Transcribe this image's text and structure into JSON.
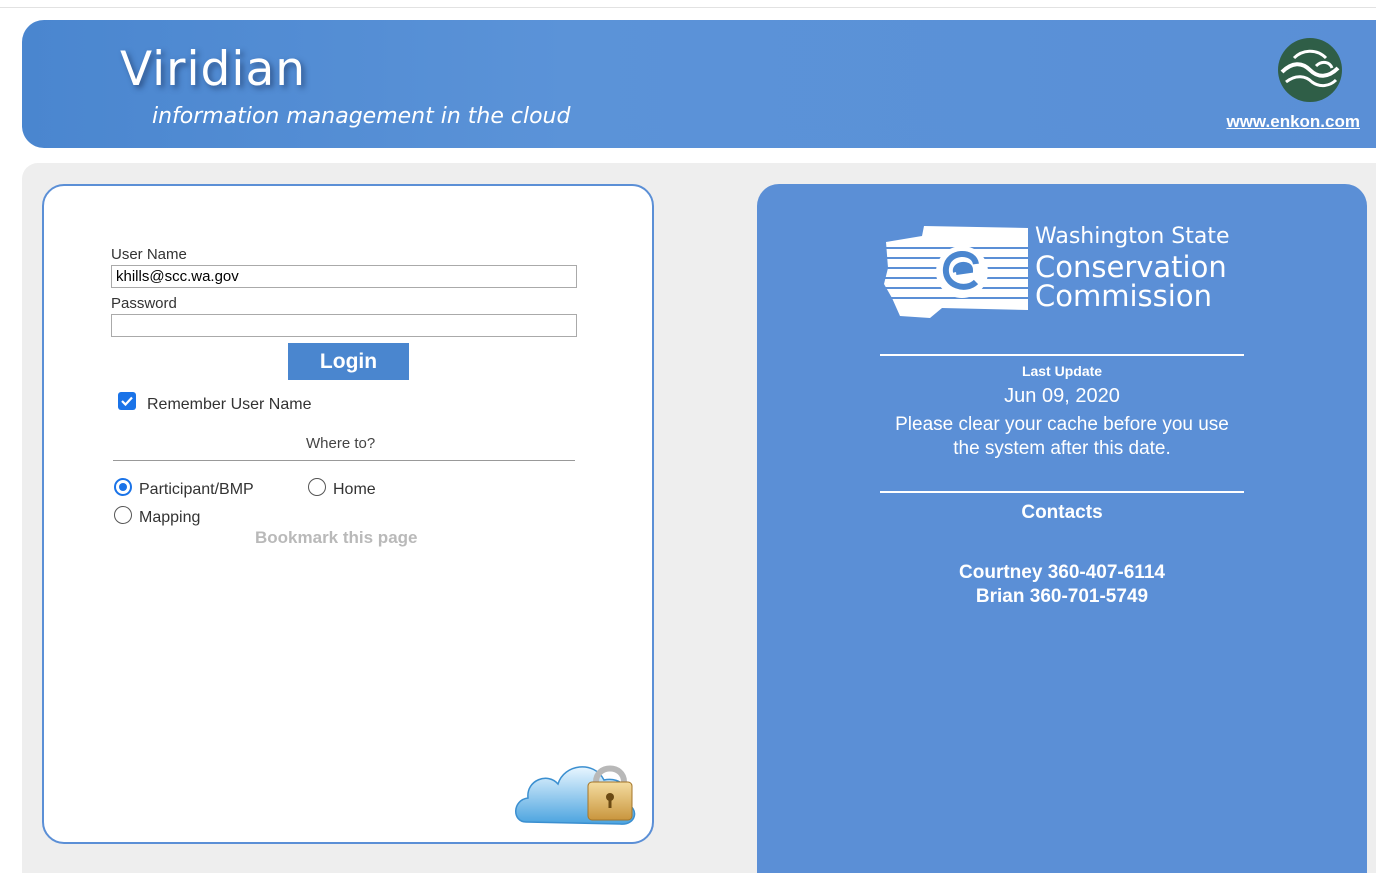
{
  "header": {
    "title": "Viridian",
    "tagline": "information management in the cloud",
    "link": "www.enkon.com"
  },
  "login": {
    "username_label": "User Name",
    "username_value": "khills@scc.wa.gov",
    "password_label": "Password",
    "password_value": "",
    "login_button": "Login",
    "remember_label": "Remember User Name",
    "remember_checked": true,
    "where_to_label": "Where to?",
    "destinations": [
      {
        "label": "Participant/BMP",
        "checked": true
      },
      {
        "label": "Home",
        "checked": false
      },
      {
        "label": "Mapping",
        "checked": false
      }
    ],
    "bookmark_label": "Bookmark this page"
  },
  "info": {
    "org_line1": "Washington State",
    "org_line2": "Conservation",
    "org_line3": "Commission",
    "last_update_label": "Last Update",
    "last_update_date": "Jun 09, 2020",
    "cache_notice_line1": "Please clear your cache before you use",
    "cache_notice_line2": "the system after this date.",
    "contacts_heading": "Contacts",
    "contacts": [
      "Courtney 360-407-6114",
      "Brian 360-701-5749"
    ]
  },
  "colors": {
    "brand_blue": "#5b8fd6",
    "button_blue": "#4a86cf",
    "check_blue": "#1a73e8"
  },
  "icons": [
    "enkon-wave-icon",
    "wscc-state-icon",
    "checkbox-checked-icon",
    "cloud-lock-icon"
  ]
}
